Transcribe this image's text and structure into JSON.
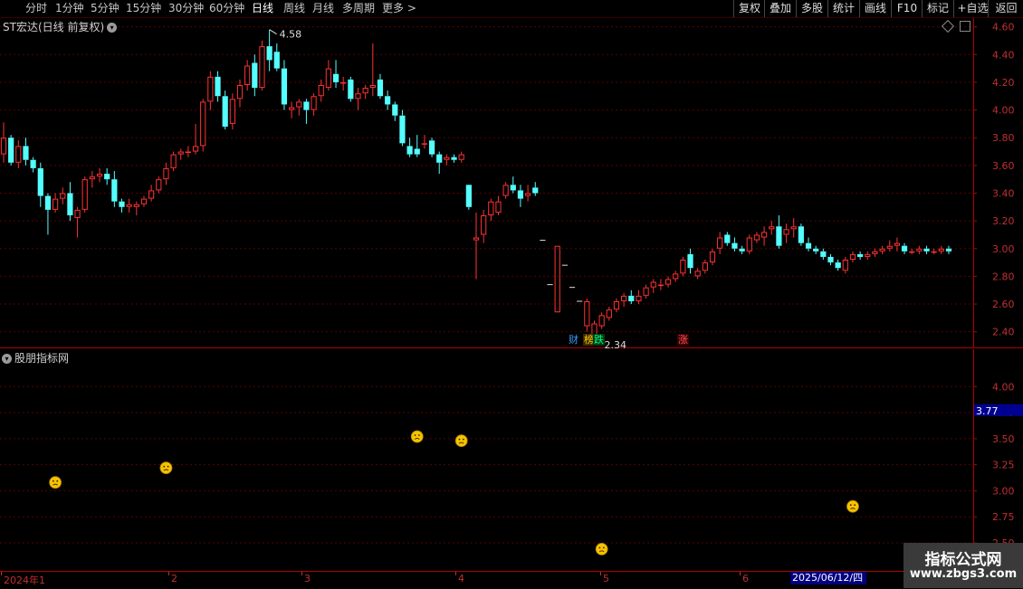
{
  "toolbar": {
    "periods": [
      "分时",
      "1分钟",
      "5分钟",
      "15分钟",
      "30分钟",
      "60分钟",
      "日线",
      "周线",
      "月线",
      "多周期",
      "更多"
    ],
    "active_period": "日线",
    "right_buttons": [
      "复权",
      "叠加",
      "多股",
      "统计",
      "画线",
      "F10",
      "标记",
      "+自选",
      "返回"
    ]
  },
  "main_panel": {
    "title": "ST宏达(日线 前复权)",
    "high_label": "4.58",
    "low_label": "2.34",
    "tags": [
      {
        "text": "财",
        "color": "#3a9cff",
        "bg": "#000"
      },
      {
        "text": "榜",
        "color": "#ffcc00",
        "bg": "#3a2a00"
      },
      {
        "text": "跌",
        "color": "#00ff88",
        "bg": "#003a10"
      },
      {
        "text": "涨",
        "color": "#ff5555",
        "bg": "#3a0000"
      }
    ],
    "y_ticks": [
      "4.60",
      "4.40",
      "4.20",
      "4.00",
      "3.80",
      "3.60",
      "3.40",
      "3.20",
      "3.00",
      "2.80",
      "2.60",
      "2.40"
    ]
  },
  "sub_panel": {
    "title": "股朋指标网",
    "y_ticks": [
      "4.00",
      "3.75",
      "3.50",
      "3.25",
      "3.00",
      "2.75",
      "2.50"
    ],
    "current_value": "3.77"
  },
  "date_axis": {
    "months": [
      "2024年1",
      "2",
      "3",
      "4",
      "5",
      "6"
    ],
    "cursor_date": "2025/06/12/四"
  },
  "watermark": {
    "line1": "指标公式网",
    "line2": "www.zbgs3.com"
  },
  "chart_data": {
    "type": "candlestick",
    "title": "ST宏达(日线 前复权)",
    "ylim": [
      2.3,
      4.65
    ],
    "up_color": "#ff3232",
    "down_color": "#54ffff",
    "candles": [
      [
        3.68,
        3.91,
        3.62,
        3.8
      ],
      [
        3.8,
        3.82,
        3.6,
        3.62
      ],
      [
        3.62,
        3.78,
        3.58,
        3.74
      ],
      [
        3.74,
        3.8,
        3.6,
        3.64
      ],
      [
        3.64,
        3.66,
        3.55,
        3.58
      ],
      [
        3.58,
        3.62,
        3.3,
        3.38
      ],
      [
        3.38,
        3.4,
        3.1,
        3.28
      ],
      [
        3.28,
        3.4,
        3.26,
        3.36
      ],
      [
        3.36,
        3.44,
        3.32,
        3.4
      ],
      [
        3.4,
        3.48,
        3.2,
        3.24
      ],
      [
        3.22,
        3.3,
        3.08,
        3.28
      ],
      [
        3.28,
        3.52,
        3.26,
        3.5
      ],
      [
        3.5,
        3.56,
        3.44,
        3.52
      ],
      [
        3.52,
        3.58,
        3.48,
        3.54
      ],
      [
        3.54,
        3.58,
        3.46,
        3.5
      ],
      [
        3.5,
        3.56,
        3.3,
        3.34
      ],
      [
        3.34,
        3.36,
        3.26,
        3.3
      ],
      [
        3.3,
        3.36,
        3.26,
        3.32
      ],
      [
        3.3,
        3.34,
        3.24,
        3.32
      ],
      [
        3.32,
        3.38,
        3.3,
        3.36
      ],
      [
        3.36,
        3.46,
        3.34,
        3.42
      ],
      [
        3.42,
        3.52,
        3.4,
        3.5
      ],
      [
        3.5,
        3.62,
        3.46,
        3.58
      ],
      [
        3.58,
        3.7,
        3.56,
        3.68
      ],
      [
        3.68,
        3.72,
        3.64,
        3.7
      ],
      [
        3.7,
        3.74,
        3.66,
        3.7
      ],
      [
        3.7,
        3.9,
        3.68,
        3.74
      ],
      [
        3.74,
        4.08,
        3.7,
        4.06
      ],
      [
        4.06,
        4.28,
        4.0,
        4.24
      ],
      [
        4.24,
        4.28,
        4.06,
        4.1
      ],
      [
        4.1,
        4.14,
        3.86,
        3.88
      ],
      [
        3.9,
        4.12,
        3.86,
        4.08
      ],
      [
        4.08,
        4.22,
        4.02,
        4.18
      ],
      [
        4.18,
        4.36,
        4.14,
        4.32
      ],
      [
        4.34,
        4.4,
        4.1,
        4.16
      ],
      [
        4.16,
        4.5,
        4.14,
        4.46
      ],
      [
        4.46,
        4.58,
        4.28,
        4.36
      ],
      [
        4.42,
        4.48,
        4.28,
        4.3
      ],
      [
        4.3,
        4.36,
        4.0,
        4.04
      ],
      [
        4.0,
        4.06,
        3.94,
        4.02
      ],
      [
        4.02,
        4.08,
        3.96,
        4.06
      ],
      [
        4.06,
        4.08,
        3.9,
        4.0
      ],
      [
        4.0,
        4.12,
        3.96,
        4.1
      ],
      [
        4.1,
        4.22,
        4.06,
        4.18
      ],
      [
        4.16,
        4.36,
        4.14,
        4.3
      ],
      [
        4.26,
        4.36,
        4.16,
        4.2
      ],
      [
        4.2,
        4.24,
        4.14,
        4.2
      ],
      [
        4.22,
        4.24,
        4.06,
        4.08
      ],
      [
        4.08,
        4.16,
        4.0,
        4.12
      ],
      [
        4.12,
        4.18,
        4.08,
        4.16
      ],
      [
        4.16,
        4.48,
        4.1,
        4.18
      ],
      [
        4.22,
        4.26,
        4.08,
        4.1
      ],
      [
        4.1,
        4.14,
        4.0,
        4.04
      ],
      [
        4.04,
        4.06,
        3.92,
        3.96
      ],
      [
        3.96,
        4.0,
        3.74,
        3.76
      ],
      [
        3.74,
        3.8,
        3.66,
        3.68
      ],
      [
        3.72,
        3.82,
        3.66,
        3.68
      ],
      [
        3.76,
        3.82,
        3.72,
        3.76
      ],
      [
        3.78,
        3.8,
        3.66,
        3.68
      ],
      [
        3.68,
        3.7,
        3.54,
        3.62
      ],
      [
        3.64,
        3.68,
        3.6,
        3.66
      ],
      [
        3.66,
        3.68,
        3.62,
        3.64
      ],
      [
        3.64,
        3.7,
        3.62,
        3.68
      ],
      [
        3.46,
        3.46,
        3.28,
        3.3
      ],
      [
        3.06,
        3.26,
        2.78,
        3.08
      ],
      [
        3.1,
        3.28,
        3.04,
        3.24
      ],
      [
        3.24,
        3.36,
        3.2,
        3.34
      ],
      [
        3.26,
        3.38,
        3.24,
        3.34
      ],
      [
        3.38,
        3.48,
        3.36,
        3.46
      ],
      [
        3.46,
        3.52,
        3.4,
        3.42
      ],
      [
        3.42,
        3.46,
        3.3,
        3.36
      ],
      [
        3.38,
        3.46,
        3.34,
        3.4
      ],
      [
        3.44,
        3.48,
        3.38,
        3.4
      ],
      [
        3.06,
        3.06,
        3.06,
        3.06
      ],
      [
        2.74,
        2.74,
        2.74,
        2.74
      ],
      [
        2.54,
        3.02,
        2.54,
        3.02
      ],
      [
        2.88,
        2.88,
        2.88,
        2.88
      ],
      [
        2.72,
        2.72,
        2.72,
        2.72
      ],
      [
        2.62,
        2.62,
        2.62,
        2.62
      ],
      [
        2.44,
        2.64,
        2.4,
        2.62
      ],
      [
        2.36,
        2.48,
        2.34,
        2.46
      ],
      [
        2.44,
        2.54,
        2.42,
        2.52
      ],
      [
        2.5,
        2.58,
        2.48,
        2.56
      ],
      [
        2.56,
        2.64,
        2.54,
        2.62
      ],
      [
        2.62,
        2.68,
        2.58,
        2.66
      ],
      [
        2.66,
        2.7,
        2.6,
        2.62
      ],
      [
        2.62,
        2.7,
        2.6,
        2.66
      ],
      [
        2.66,
        2.74,
        2.64,
        2.72
      ],
      [
        2.72,
        2.78,
        2.68,
        2.76
      ],
      [
        2.74,
        2.78,
        2.7,
        2.74
      ],
      [
        2.74,
        2.8,
        2.72,
        2.78
      ],
      [
        2.78,
        2.84,
        2.76,
        2.82
      ],
      [
        2.82,
        2.94,
        2.8,
        2.92
      ],
      [
        2.96,
        3.0,
        2.82,
        2.86
      ],
      [
        2.8,
        2.86,
        2.78,
        2.84
      ],
      [
        2.84,
        2.92,
        2.82,
        2.9
      ],
      [
        2.9,
        3.0,
        2.88,
        2.98
      ],
      [
        3.0,
        3.12,
        2.96,
        3.08
      ],
      [
        3.1,
        3.12,
        3.02,
        3.04
      ],
      [
        3.04,
        3.08,
        2.98,
        3.0
      ],
      [
        3.0,
        3.02,
        2.96,
        2.98
      ],
      [
        2.98,
        3.1,
        2.96,
        3.08
      ],
      [
        3.06,
        3.12,
        3.04,
        3.1
      ],
      [
        3.08,
        3.16,
        3.02,
        3.12
      ],
      [
        3.14,
        3.2,
        3.1,
        3.16
      ],
      [
        3.16,
        3.24,
        3.0,
        3.02
      ],
      [
        3.1,
        3.18,
        3.04,
        3.14
      ],
      [
        3.14,
        3.22,
        3.08,
        3.16
      ],
      [
        3.16,
        3.18,
        3.02,
        3.04
      ],
      [
        3.04,
        3.08,
        2.98,
        3.0
      ],
      [
        3.0,
        3.02,
        2.96,
        2.98
      ],
      [
        2.98,
        3.0,
        2.92,
        2.94
      ],
      [
        2.94,
        2.96,
        2.88,
        2.9
      ],
      [
        2.9,
        2.92,
        2.84,
        2.86
      ],
      [
        2.84,
        2.94,
        2.82,
        2.92
      ],
      [
        2.92,
        2.98,
        2.9,
        2.96
      ],
      [
        2.96,
        2.98,
        2.92,
        2.94
      ],
      [
        2.94,
        2.98,
        2.92,
        2.96
      ],
      [
        2.96,
        3.0,
        2.94,
        2.98
      ],
      [
        2.98,
        3.02,
        2.96,
        3.0
      ],
      [
        3.0,
        3.06,
        2.98,
        3.02
      ],
      [
        3.02,
        3.08,
        2.98,
        3.04
      ],
      [
        3.02,
        3.04,
        2.96,
        2.98
      ],
      [
        2.98,
        3.0,
        2.96,
        2.98
      ],
      [
        2.98,
        3.02,
        2.96,
        3.0
      ],
      [
        3.0,
        3.02,
        2.96,
        2.98
      ],
      [
        2.98,
        3.0,
        2.96,
        2.98
      ],
      [
        2.98,
        3.02,
        2.96,
        3.0
      ],
      [
        3.0,
        3.02,
        2.96,
        2.98
      ]
    ],
    "indicator": {
      "ylim": [
        2.5,
        4.15
      ],
      "points": [
        {
          "i": 7,
          "v": 3.08
        },
        {
          "i": 22,
          "v": 3.22
        },
        {
          "i": 56,
          "v": 3.52
        },
        {
          "i": 62,
          "v": 3.48
        },
        {
          "i": 81,
          "v": 2.44
        },
        {
          "i": 115,
          "v": 2.85
        }
      ]
    }
  }
}
